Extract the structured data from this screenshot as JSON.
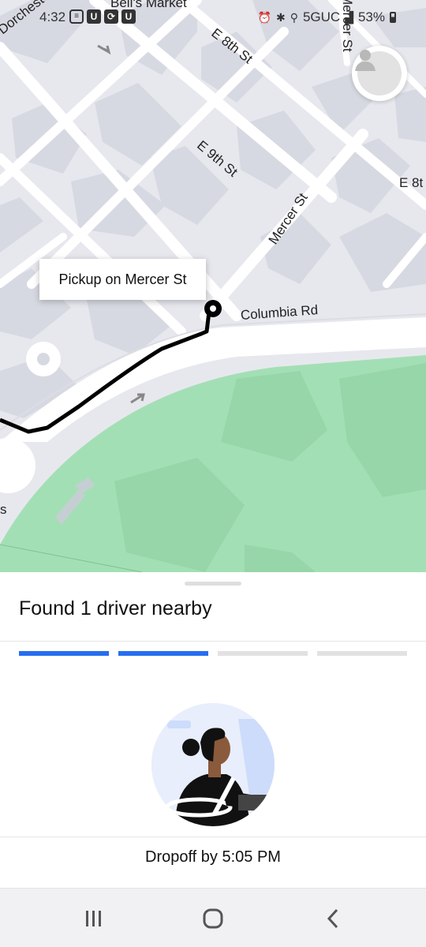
{
  "status_bar": {
    "time": "4:32",
    "left_icons": [
      "notification-icon",
      "u-icon",
      "sync-icon",
      "u-icon"
    ],
    "alarm_icon": "alarm-icon",
    "bluetooth_icon": "bluetooth-icon",
    "location_icon": "location-icon",
    "network": "5GUC",
    "battery": "53%"
  },
  "map": {
    "streets": {
      "dorchester": "Dorchester St",
      "place": "Bell's Market",
      "e8th": "E 8th St",
      "e8th_right": "E 8t",
      "e9th": "E 9th St",
      "mercer": "Mercer St",
      "mercer_top": "Mercer St",
      "columbia": "Columbia Rd",
      "left_edge": "s"
    },
    "pickup_label": "Pickup on Mercer St",
    "colors": {
      "park": "#a3dfb4",
      "road": "#ffffff",
      "block": "#d7d9e2",
      "route": "#000000"
    }
  },
  "sheet": {
    "title": "Found 1 driver nearby",
    "progress": {
      "active": 2,
      "total": 4,
      "accent": "#276ef1"
    },
    "dropoff": "Dropoff by 5:05 PM"
  },
  "navbar": {
    "recent": "recent-apps-icon",
    "home": "home-icon",
    "back": "back-icon"
  }
}
